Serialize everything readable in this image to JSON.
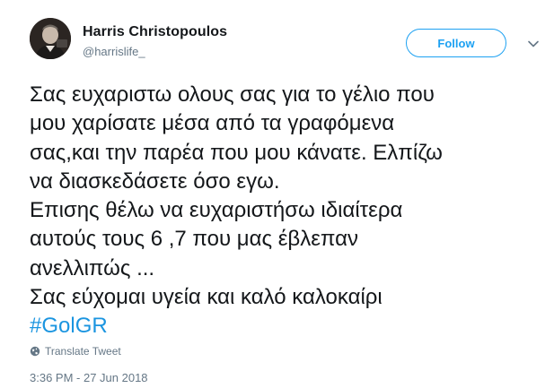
{
  "author": {
    "name": "Harris Christopoulos",
    "handle": "@harrislife_"
  },
  "follow_button": {
    "label": "Follow",
    "color": "#1da1f2"
  },
  "tweet": {
    "lines": [
      "Σας ευχαριστω ολους σας για το γέλιο που",
      "μου χαρίσατε μέσα από τα γραφόμενα",
      "σας,και την παρέα που μου κάνατε.  Ελπίζω",
      "να διασκεδάσετε όσο εγω.",
      "Επισης θέλω να ευχαριστήσω ιδιαίτερα",
      "αυτούς τους 6 ,7 που μας έβλεπαν",
      "ανελλιπώς ...",
      "Σας εύχομαι υγεία και καλό καλοκαίρι"
    ],
    "hashtag": "#GolGR",
    "hashtag_color": "#1b95e0"
  },
  "translate": {
    "label": "Translate Tweet",
    "icon": "globe-icon"
  },
  "timestamp": "3:36 PM - 27 Jun 2018",
  "icons": {
    "menu": "chevron-down-icon",
    "avatar": "profile-photo"
  }
}
